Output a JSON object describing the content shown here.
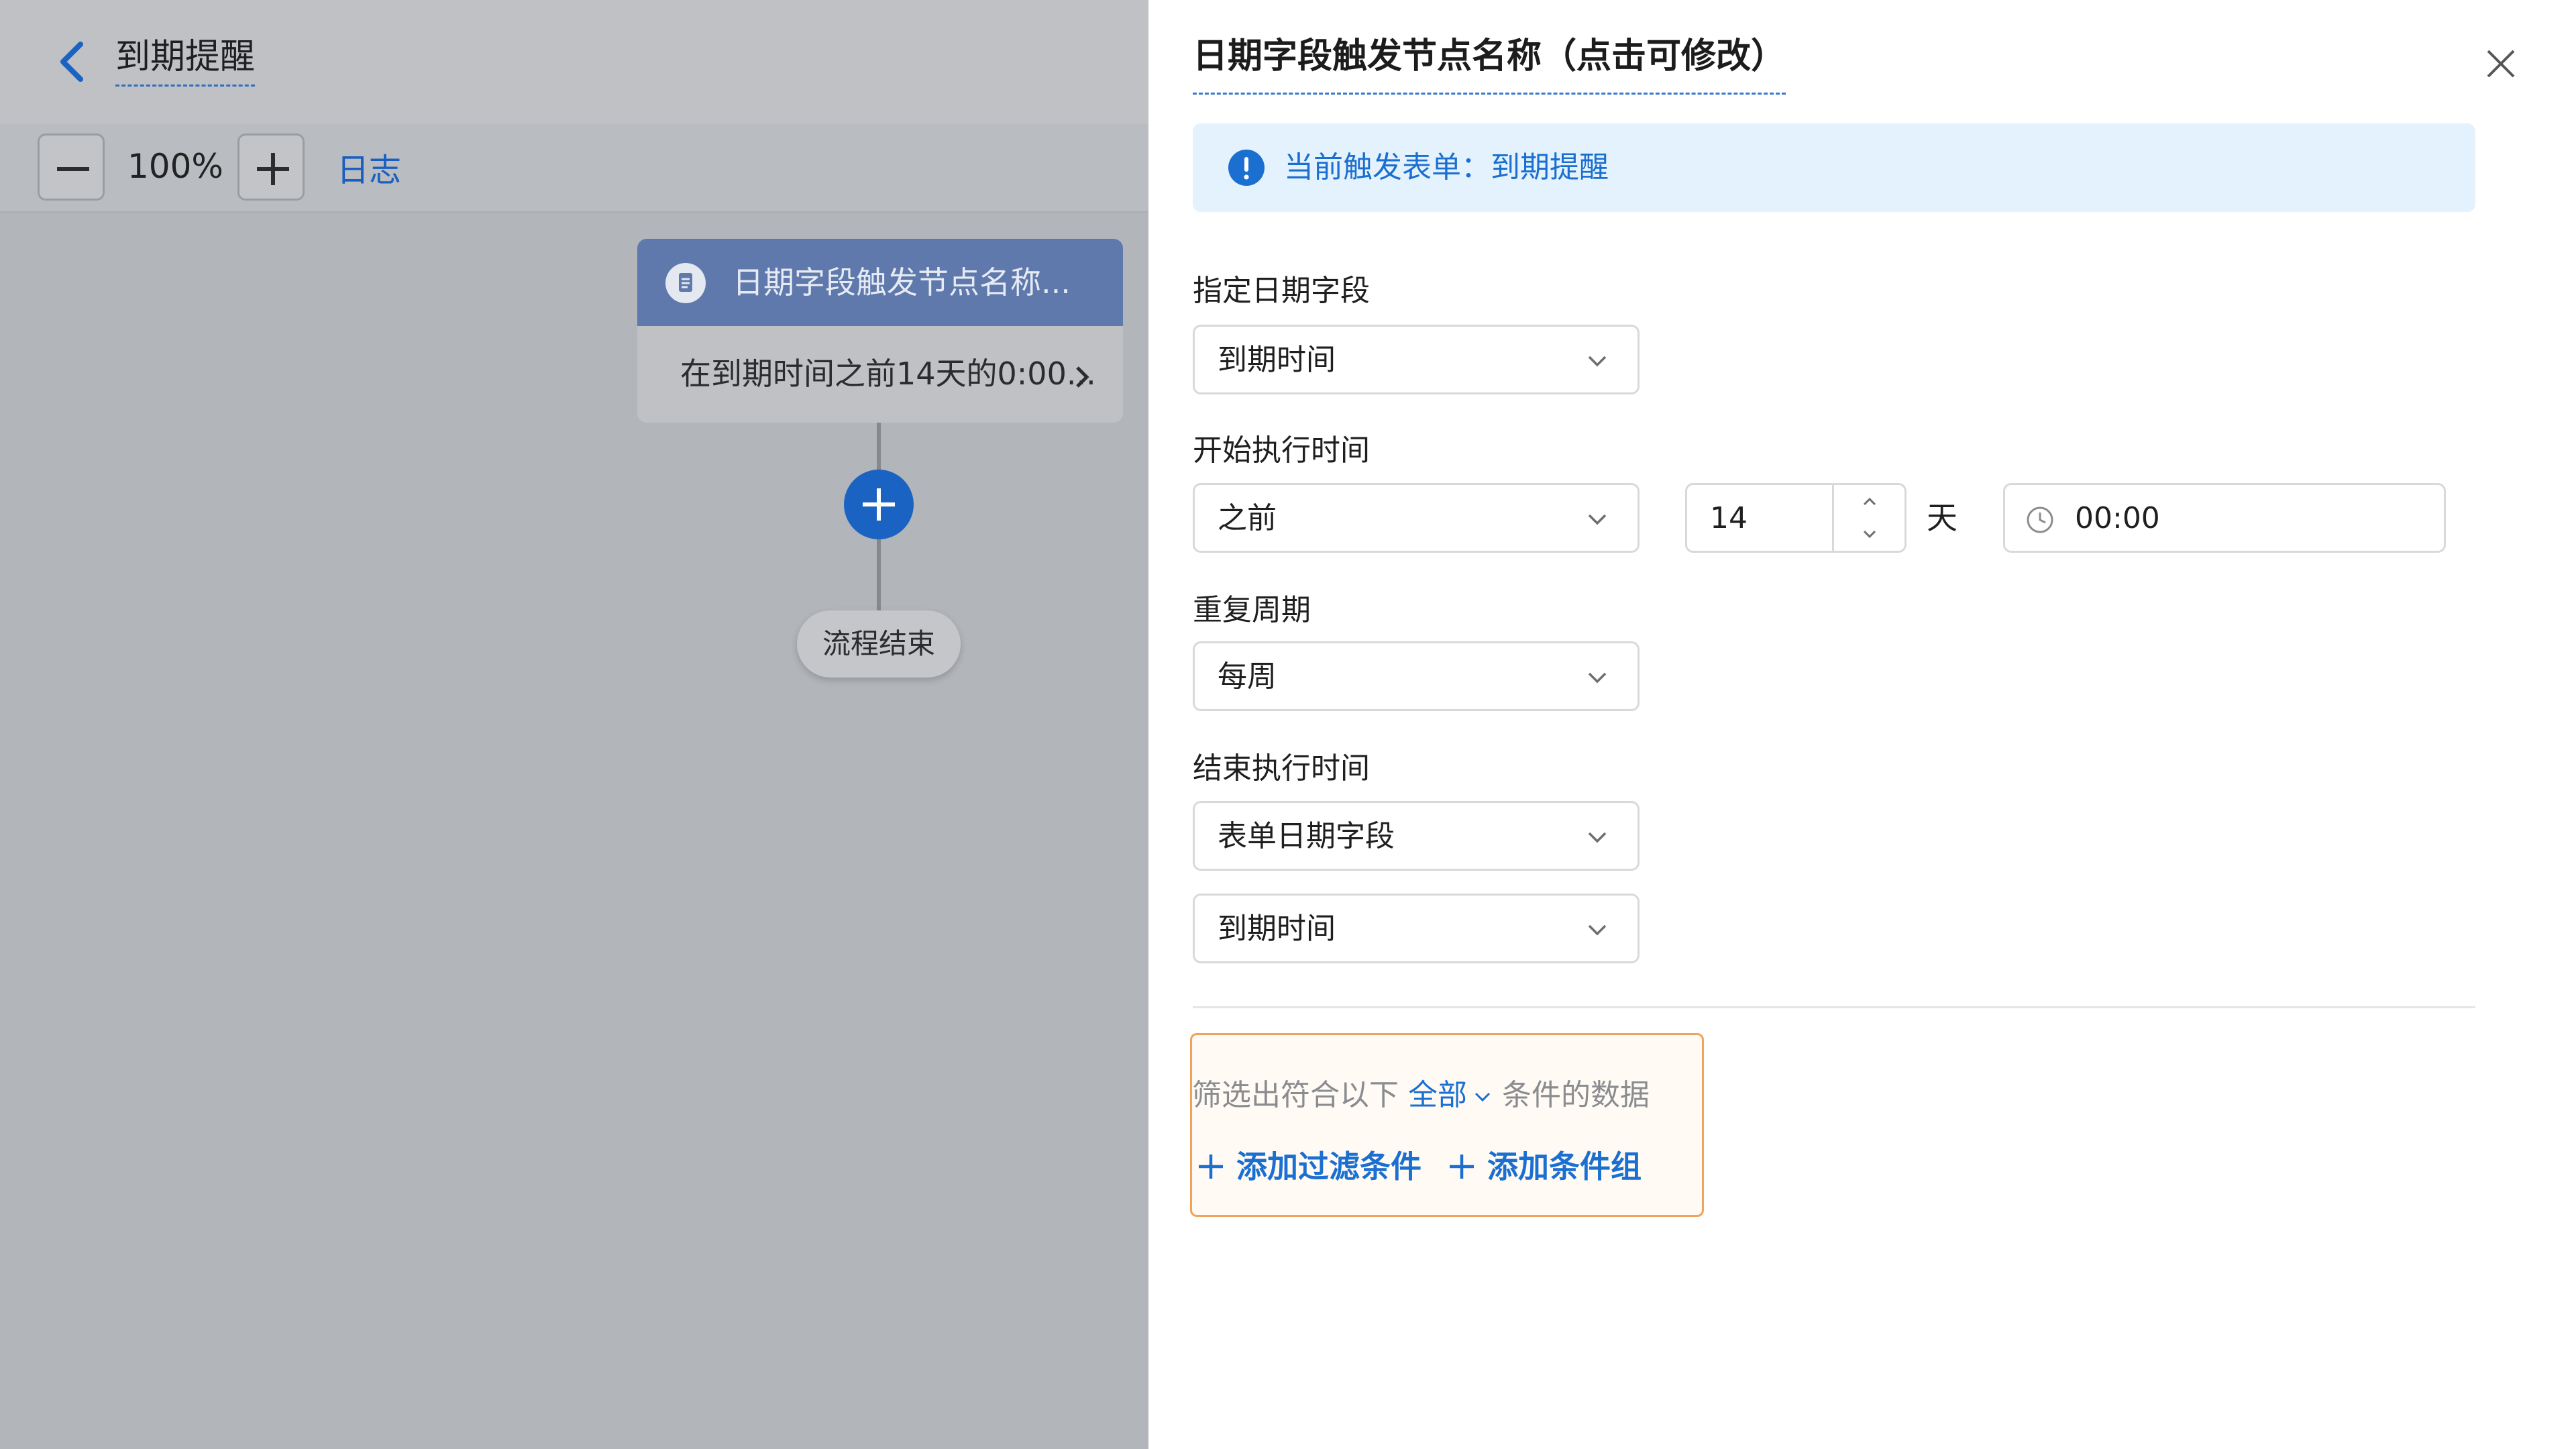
{
  "header": {
    "flow_title": "到期提醒"
  },
  "toolbar": {
    "zoom": "100%",
    "log_label": "日志"
  },
  "canvas": {
    "node": {
      "title": "日期字段触发节点名称...",
      "summary": "在到期时间之前14天的0:00..."
    },
    "end_label": "流程结束"
  },
  "panel": {
    "title": "日期字段触发节点名称（点击可修改）",
    "banner": "当前触发表单：到期提醒",
    "date_field": {
      "label": "指定日期字段",
      "value": "到期时间"
    },
    "start_time": {
      "label": "开始执行时间",
      "relation": "之前",
      "days": "14",
      "unit": "天",
      "time": "00:00"
    },
    "repeat": {
      "label": "重复周期",
      "value": "每周"
    },
    "end_time": {
      "label": "结束执行时间",
      "type": "表单日期字段",
      "field": "到期时间"
    },
    "filter": {
      "prefix": "筛选出符合以下",
      "mode": "全部",
      "suffix": "条件的数据",
      "add_filter": "添加过滤条件",
      "add_group": "添加条件组"
    }
  },
  "colors": {
    "accent": "#1a6fd0",
    "banner_bg": "#e4f2fd",
    "filter_border": "#f0a35a",
    "node_header": "#5f79ac"
  }
}
